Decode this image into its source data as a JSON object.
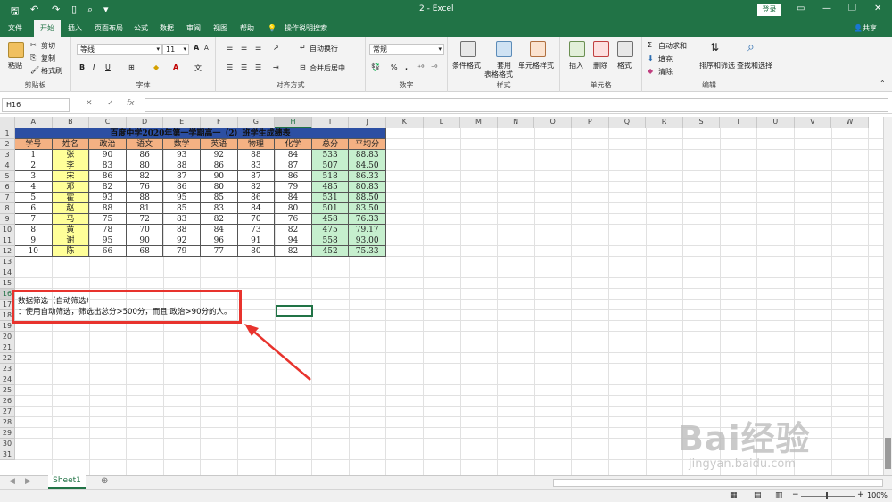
{
  "window": {
    "title": "2 - Excel",
    "login_label": "登录",
    "share_label": "共享"
  },
  "menu": {
    "tabs": [
      "文件",
      "开始",
      "插入",
      "页面布局",
      "公式",
      "数据",
      "审阅",
      "视图",
      "帮助"
    ],
    "search_label": "操作说明搜索"
  },
  "ribbon": {
    "clipboard": {
      "paste": "粘贴",
      "cut": "剪切",
      "copy": "复制",
      "format_painter": "格式刷",
      "label": "剪贴板"
    },
    "font": {
      "name": "等线",
      "size": "11",
      "bold": "B",
      "italic": "I",
      "underline": "U",
      "grow": "A",
      "shrink": "A",
      "label": "字体"
    },
    "alignment": {
      "wrap": "自动换行",
      "merge": "合并后居中",
      "label": "对齐方式"
    },
    "number": {
      "format": "常规",
      "percent": "%",
      "comma": ",",
      "label": "数字"
    },
    "styles": {
      "conditional": "条件格式",
      "table_line1": "套用",
      "table_line2": "表格格式",
      "cell_styles": "单元格样式",
      "label": "样式"
    },
    "cells": {
      "insert": "插入",
      "delete": "删除",
      "format": "格式",
      "label": "单元格"
    },
    "editing": {
      "autosum": "自动求和",
      "fill": "填充",
      "clear": "清除",
      "sort": "排序和筛选",
      "find": "查找和选择",
      "label": "编辑"
    }
  },
  "formula_bar": {
    "name_box": "H16",
    "cancel": "✕",
    "enter": "✓",
    "fx": "fx",
    "value": ""
  },
  "columns": [
    "A",
    "B",
    "C",
    "D",
    "E",
    "F",
    "G",
    "H",
    "I",
    "J",
    "K",
    "L",
    "M",
    "N",
    "O",
    "P",
    "Q",
    "R",
    "S",
    "T",
    "U",
    "V",
    "W"
  ],
  "selected_column": "H",
  "rows": [
    "1",
    "2",
    "3",
    "4",
    "5",
    "6",
    "7",
    "8",
    "9",
    "10",
    "11",
    "12",
    "13",
    "14",
    "15",
    "16",
    "17",
    "18",
    "19",
    "20",
    "21",
    "22",
    "23",
    "24",
    "25",
    "26",
    "27",
    "28",
    "29",
    "30",
    "31"
  ],
  "selected_row": "16",
  "table": {
    "title": "百度中学2020年第一学期高一（2）班学生成绩表",
    "headers": [
      "学号",
      "姓名",
      "政治",
      "语文",
      "数学",
      "英语",
      "物理",
      "化学",
      "总分",
      "平均分"
    ],
    "rows": [
      [
        "1",
        "张",
        "90",
        "86",
        "93",
        "92",
        "88",
        "84",
        "533",
        "88.83"
      ],
      [
        "2",
        "李",
        "83",
        "80",
        "88",
        "86",
        "83",
        "87",
        "507",
        "84.50"
      ],
      [
        "3",
        "宋",
        "86",
        "82",
        "87",
        "90",
        "87",
        "86",
        "518",
        "86.33"
      ],
      [
        "4",
        "邓",
        "82",
        "76",
        "86",
        "80",
        "82",
        "79",
        "485",
        "80.83"
      ],
      [
        "5",
        "霍",
        "93",
        "88",
        "95",
        "85",
        "86",
        "84",
        "531",
        "88.50"
      ],
      [
        "6",
        "赵",
        "88",
        "81",
        "85",
        "83",
        "84",
        "80",
        "501",
        "83.50"
      ],
      [
        "7",
        "马",
        "75",
        "72",
        "83",
        "82",
        "70",
        "76",
        "458",
        "76.33"
      ],
      [
        "8",
        "黄",
        "78",
        "70",
        "88",
        "84",
        "73",
        "82",
        "475",
        "79.17"
      ],
      [
        "9",
        "谢",
        "95",
        "90",
        "92",
        "96",
        "91",
        "94",
        "558",
        "93.00"
      ],
      [
        "10",
        "陈",
        "66",
        "68",
        "79",
        "77",
        "80",
        "82",
        "452",
        "75.33"
      ]
    ]
  },
  "notes": {
    "line1": "数据筛选（自动筛选）",
    "line2": "：使用自动筛选，筛选出总分>500分，而且 政治>90分的人。"
  },
  "sheet_tab": "Sheet1",
  "status": {
    "zoom": "100%"
  },
  "watermark": {
    "logo": "Bai经验",
    "url": "jingyan.baidu.com"
  },
  "colors": {
    "excel_green": "#217346",
    "title_fill": "#2c4fa3",
    "header_fill": "#f4b183",
    "name_fill": "#ffff99",
    "total_fill": "#c6efce",
    "highlight_red": "#e8332d"
  }
}
